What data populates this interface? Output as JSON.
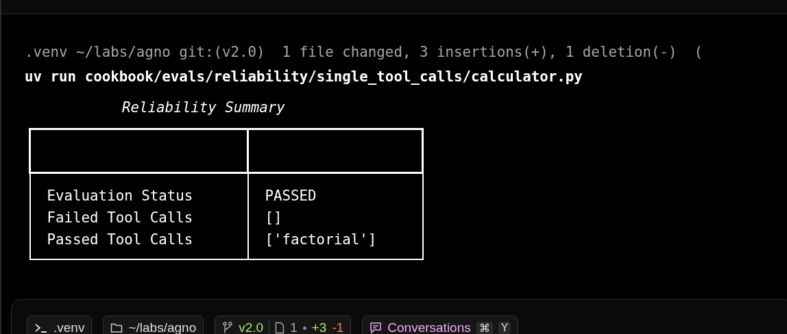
{
  "terminal": {
    "prompt_line": ".venv ~/labs/agno git:(v2.0)  1 file changed, 3 insertions(+), 1 deletion(-)  (",
    "command": "uv run cookbook/evals/reliability/single_tool_calls/calculator.py",
    "table_title": "Reliability Summary",
    "rows": [
      {
        "label": "Evaluation Status",
        "value": "PASSED"
      },
      {
        "label": "Failed Tool Calls",
        "value": "[]"
      },
      {
        "label": "Passed Tool Calls",
        "value": "['factorial']"
      }
    ]
  },
  "status_bar": {
    "env": ".venv",
    "path": "~/labs/agno",
    "branch": "v2.0",
    "files": "1",
    "insertions": "+3",
    "deletions": "-1",
    "conversations": "Conversations",
    "shortcut_keys": [
      "⌘",
      "Y"
    ]
  }
}
